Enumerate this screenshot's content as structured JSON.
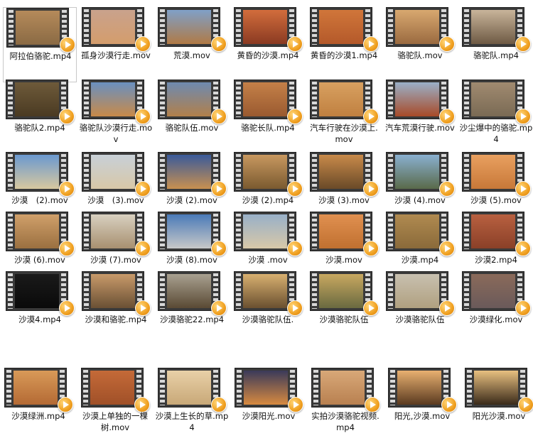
{
  "icon": "video-file-icon",
  "rows": [
    [
      {
        "name": "阿拉伯骆驼.mp4",
        "colors": [
          "#b58a5a",
          "#8a6a44"
        ],
        "selected": true
      },
      {
        "name": "孤身沙漠行走.mov",
        "colors": [
          "#c9a28c",
          "#d49d6c"
        ]
      },
      {
        "name": "荒漠.mov",
        "colors": [
          "#7fa0c8",
          "#b07a45"
        ]
      },
      {
        "name": "黄昏的沙漠.mp4",
        "colors": [
          "#d26d3c",
          "#8a3a22"
        ]
      },
      {
        "name": "黄昏的沙漠1.mp4",
        "colors": [
          "#d0763a",
          "#b4592a"
        ]
      },
      {
        "name": "骆驼队.mov",
        "colors": [
          "#d8a870",
          "#9a6a40"
        ]
      },
      {
        "name": "骆驼队.mp4",
        "colors": [
          "#c8b49a",
          "#6e5a44"
        ]
      }
    ],
    [
      {
        "name": "骆驼队2.mp4",
        "colors": [
          "#6e5a3a",
          "#4a3a22"
        ]
      },
      {
        "name": "骆驼队沙漠行走.mov",
        "colors": [
          "#6a90c0",
          "#c88a48"
        ]
      },
      {
        "name": "骆驼队伍.mov",
        "colors": [
          "#6e8ab0",
          "#b2804a"
        ]
      },
      {
        "name": "骆驼长队.mp4",
        "colors": [
          "#c48048",
          "#9a5a30"
        ]
      },
      {
        "name": "汽车行驶在沙漠上.mov",
        "colors": [
          "#d8a060",
          "#c08040"
        ]
      },
      {
        "name": "汽车荒漠行驶.mov",
        "colors": [
          "#9ab0c8",
          "#a84a28"
        ]
      },
      {
        "name": "沙尘爆中的骆驼.mp4",
        "colors": [
          "#a08a70",
          "#7a6a54"
        ]
      }
    ],
    [
      {
        "name": "沙漠　(2).mov",
        "colors": [
          "#6a98d0",
          "#d8c8a0"
        ]
      },
      {
        "name": "沙漠　(3).mov",
        "colors": [
          "#c8d0d8",
          "#d8c8a8"
        ]
      },
      {
        "name": "沙漠 (2).mov",
        "colors": [
          "#3a5a9a",
          "#c89050"
        ]
      },
      {
        "name": "沙漠 (2).mp4",
        "colors": [
          "#c89860",
          "#7a5a30"
        ]
      },
      {
        "name": "沙漠 (3).mov",
        "colors": [
          "#c88a4a",
          "#6a4a28"
        ]
      },
      {
        "name": "沙漠 (4).mov",
        "colors": [
          "#8ab0d0",
          "#5a6a4a"
        ]
      },
      {
        "name": "沙漠 (5).mov",
        "colors": [
          "#e8a060",
          "#c87838"
        ]
      }
    ],
    [
      {
        "name": "沙漠 (6).mov",
        "colors": [
          "#d0a06a",
          "#9a7040"
        ]
      },
      {
        "name": "沙漠 (7).mov",
        "colors": [
          "#d8d0c0",
          "#a89070"
        ]
      },
      {
        "name": "沙漠 (8).mov",
        "colors": [
          "#4a7ab8",
          "#c8c8c8"
        ]
      },
      {
        "name": "沙漠 .mov",
        "colors": [
          "#98b0c8",
          "#d8c8a8"
        ]
      },
      {
        "name": "沙漠.mov",
        "colors": [
          "#e09050",
          "#c07030"
        ]
      },
      {
        "name": "沙漠.mp4",
        "colors": [
          "#b08a50",
          "#8a6a3a"
        ]
      },
      {
        "name": "沙漠2.mp4",
        "colors": [
          "#b86040",
          "#8a4028"
        ]
      }
    ],
    [
      {
        "name": "沙漠4.mp4",
        "colors": [
          "#1a1a1a",
          "#0a0a0a"
        ]
      },
      {
        "name": "沙漠和骆驼.mp4",
        "colors": [
          "#c89a6a",
          "#6a5034"
        ]
      },
      {
        "name": "沙漠骆驼22.mp4",
        "colors": [
          "#a8a090",
          "#5a4a34"
        ]
      },
      {
        "name": "沙漠骆驼队伍.",
        "colors": [
          "#d8b070",
          "#6a5030"
        ]
      },
      {
        "name": "沙漠骆驼队伍",
        "colors": [
          "#c8a860",
          "#6a6a40"
        ]
      },
      {
        "name": "沙漠骆驼队伍",
        "colors": [
          "#c8c0b0",
          "#b0a080"
        ]
      },
      {
        "name": "沙漠绿化.mov",
        "colors": [
          "#8a6a5a",
          "#6a5a5a"
        ]
      }
    ]
  ],
  "bottom_row": [
    {
      "name": "沙漠绿洲.mp4",
      "colors": [
        "#d89a58",
        "#b46a34"
      ]
    },
    {
      "name": "沙漠上单独的一棵树.mov",
      "colors": [
        "#c46a38",
        "#a05028"
      ]
    },
    {
      "name": "沙漠上生长的草.mp4",
      "colors": [
        "#e8d0a8",
        "#c8a878"
      ]
    },
    {
      "name": "沙漠阳光.mov",
      "colors": [
        "#3a3a5a",
        "#d88a40"
      ]
    },
    {
      "name": "实拍沙漠骆驼视频.mp4",
      "colors": [
        "#d8a878",
        "#b88050"
      ]
    },
    {
      "name": "阳光,沙漠.mov",
      "colors": [
        "#e8b070",
        "#5a3a20"
      ]
    },
    {
      "name": "阳光沙漠.mov",
      "colors": [
        "#e8c080",
        "#3a2a1a"
      ]
    }
  ]
}
